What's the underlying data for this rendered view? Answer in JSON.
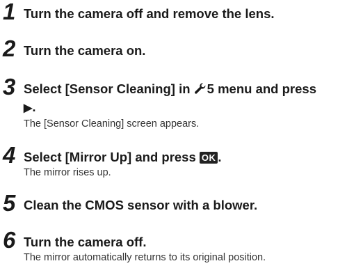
{
  "steps": [
    {
      "number": "1",
      "title": "Turn the camera off and remove the lens."
    },
    {
      "number": "2",
      "title": "Turn the camera on."
    },
    {
      "number": "3",
      "title_part1": "Select [Sensor Cleaning] in ",
      "menu_icon": "wrench-icon",
      "menu_number": "5",
      "title_part2": " menu and press",
      "arrow_glyph": "▶",
      "title_end": ".",
      "description": "The [Sensor Cleaning] screen appears."
    },
    {
      "number": "4",
      "title_part1": "Select [Mirror Up] and press ",
      "ok_label": "OK",
      "title_end": ".",
      "description": "The mirror rises up."
    },
    {
      "number": "5",
      "title": "Clean the CMOS sensor with a blower."
    },
    {
      "number": "6",
      "title": "Turn the camera off.",
      "description": "The mirror automatically returns to its original position."
    }
  ]
}
